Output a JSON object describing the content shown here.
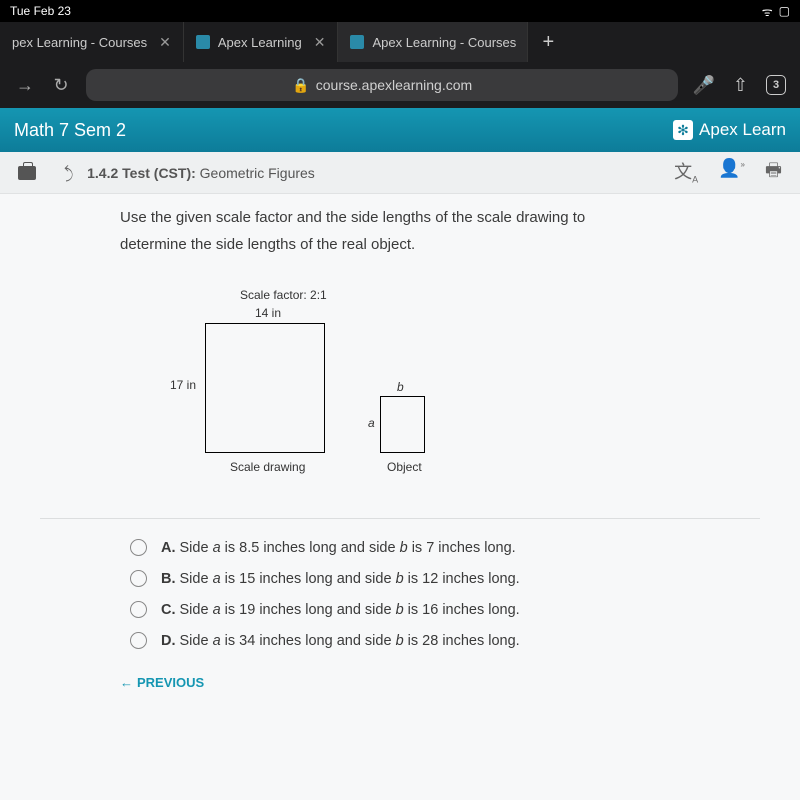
{
  "status": {
    "time": "Tue Feb 23",
    "wifi": "⚡",
    "batt": "▸"
  },
  "tabs": {
    "t0": "pex Learning - Courses",
    "t1": "Apex Learning",
    "t2": "Apex Learning - Courses"
  },
  "url": {
    "lock": "🔒",
    "text": "course.apexlearning.com",
    "tabcount": "3"
  },
  "header": {
    "course": "Math 7 Sem 2",
    "brand": "Apex Learn"
  },
  "crumb": {
    "code": "1.4.2",
    "kind": "Test (CST):",
    "title": "Geometric Figures"
  },
  "question": {
    "line1": "Use the given scale factor and the side lengths of the scale drawing to",
    "line2": "determine the side lengths of the real object."
  },
  "figure": {
    "scale_factor": "Scale factor: 2:1",
    "top": "14 in",
    "side": "17 in",
    "a": "a",
    "b": "b",
    "cap_big": "Scale drawing",
    "cap_small": "Object"
  },
  "options": {
    "A": {
      "letter": "A.",
      "pre": "Side ",
      "a": "a",
      "mid1": " is 8.5 inches long and side ",
      "b": "b",
      "post": " is 7 inches long."
    },
    "B": {
      "letter": "B.",
      "pre": "Side ",
      "a": "a",
      "mid1": " is 15 inches long and side ",
      "b": "b",
      "post": " is 12 inches long."
    },
    "C": {
      "letter": "C.",
      "pre": "Side ",
      "a": "a",
      "mid1": " is 19 inches long and side ",
      "b": "b",
      "post": " is 16 inches long."
    },
    "D": {
      "letter": "D.",
      "pre": "Side ",
      "a": "a",
      "mid1": " is 34 inches long and side ",
      "b": "b",
      "post": " is 28 inches long."
    }
  },
  "nav": {
    "previous": "PREVIOUS"
  }
}
